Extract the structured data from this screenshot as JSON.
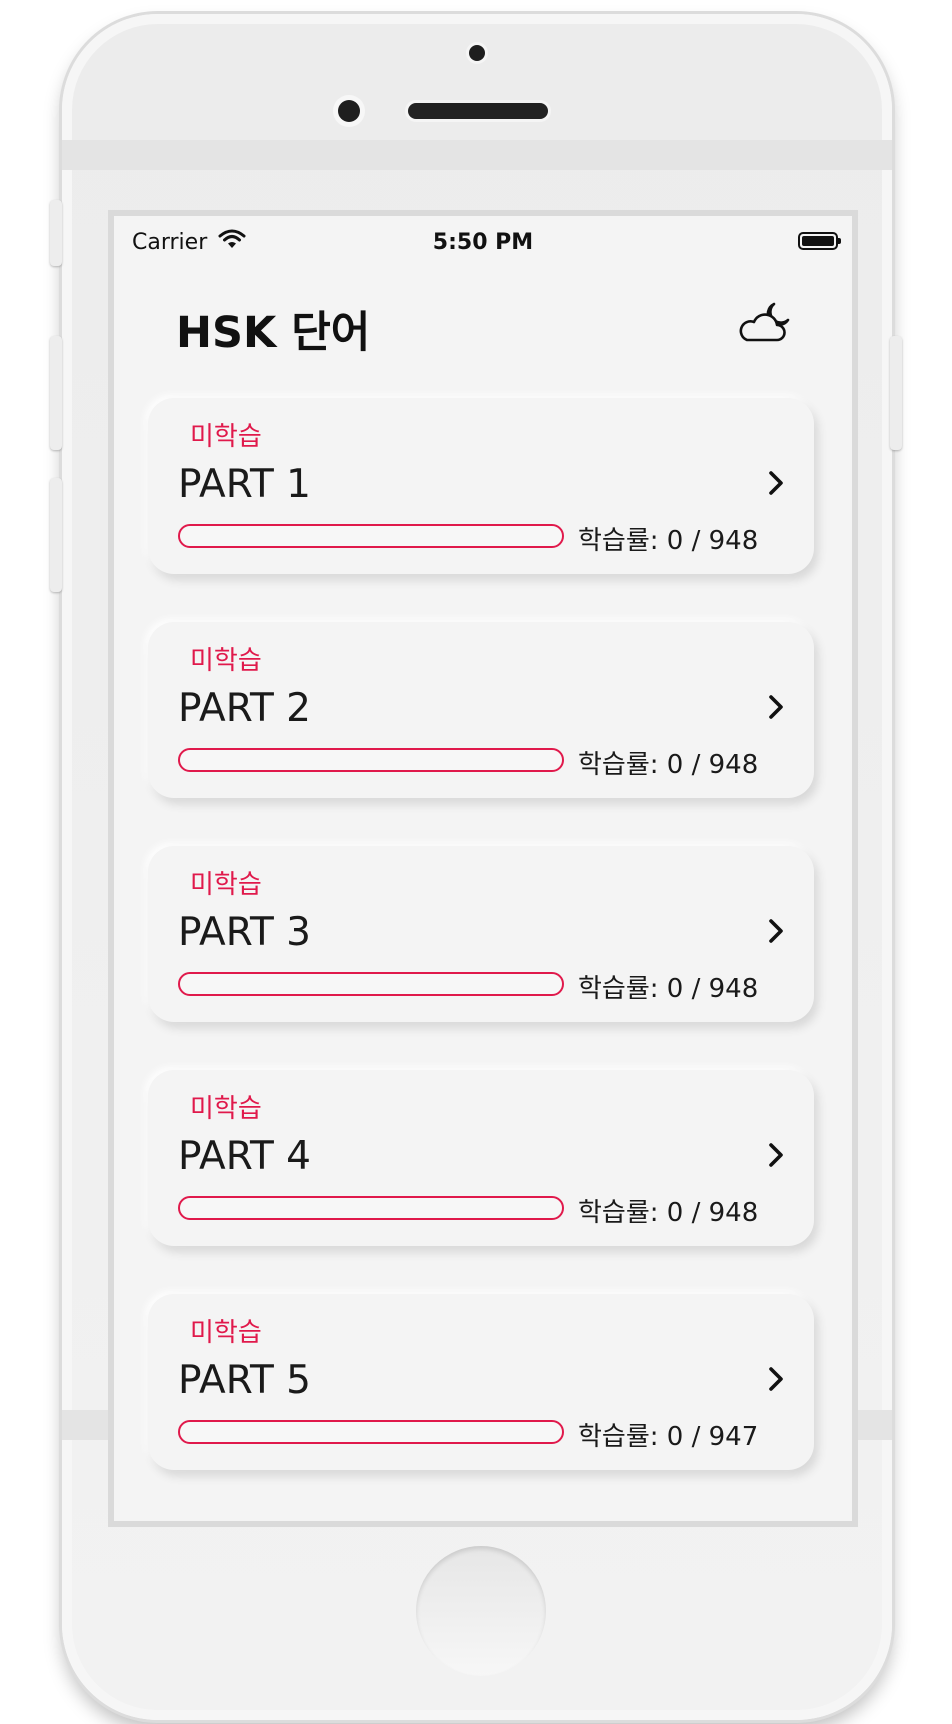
{
  "status_bar": {
    "carrier": "Carrier",
    "time": "5:50 PM",
    "wifi_icon": "wifi-icon",
    "battery_icon": "battery-icon"
  },
  "header": {
    "title": "HSK 단어",
    "theme_icon": "cloud-moon-icon"
  },
  "accent_color": "#e0194b",
  "parts": [
    {
      "status": "미학습",
      "title": "PART 1",
      "progress_label": "학습률: 0 / 948",
      "learned": 0,
      "total": 948
    },
    {
      "status": "미학습",
      "title": "PART 2",
      "progress_label": "학습률: 0 / 948",
      "learned": 0,
      "total": 948
    },
    {
      "status": "미학습",
      "title": "PART 3",
      "progress_label": "학습률: 0 / 948",
      "learned": 0,
      "total": 948
    },
    {
      "status": "미학습",
      "title": "PART 4",
      "progress_label": "학습률: 0 / 948",
      "learned": 0,
      "total": 948
    },
    {
      "status": "미학습",
      "title": "PART 5",
      "progress_label": "학습률: 0 / 947",
      "learned": 0,
      "total": 947
    }
  ]
}
